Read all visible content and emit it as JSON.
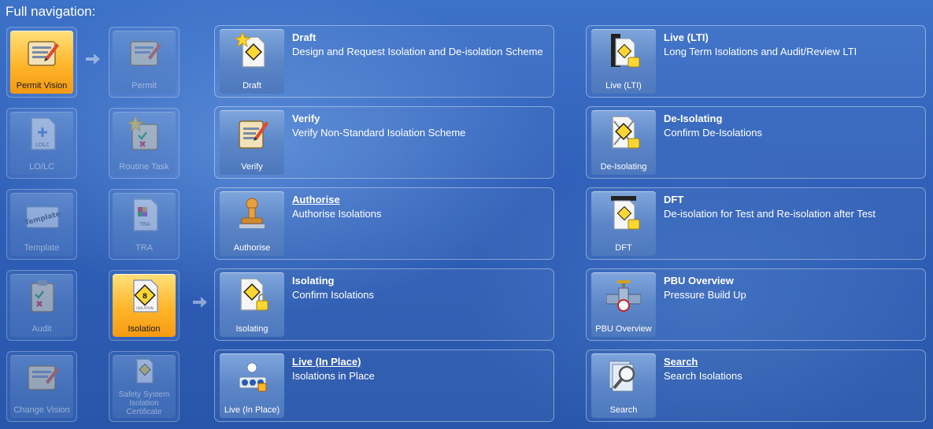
{
  "heading": "Full navigation:",
  "left_tiles": [
    {
      "label": "Permit Vision",
      "icon": "permit-vision-icon",
      "state": "active"
    },
    {
      "label": "Permit",
      "icon": "permit-icon",
      "state": "dim"
    },
    {
      "label": "LO/LC",
      "icon": "lolc-icon",
      "state": "dim"
    },
    {
      "label": "Routine Task",
      "icon": "routine-task-icon",
      "state": "dim"
    },
    {
      "label": "Template",
      "icon": "template-icon",
      "state": "dim"
    },
    {
      "label": "TRA",
      "icon": "tra-icon",
      "state": "dim"
    },
    {
      "label": "Audit",
      "icon": "audit-icon",
      "state": "dim"
    },
    {
      "label": "Isolation",
      "icon": "isolation-icon",
      "state": "active"
    },
    {
      "label": "Change Vision",
      "icon": "change-vision-icon",
      "state": "dim"
    },
    {
      "label": "Safety System Isolation Certificate",
      "icon": "safety-cert-icon",
      "state": "dim"
    }
  ],
  "icon_text": {
    "lolc": "LOLC",
    "template": "Template",
    "tra": "TRA",
    "isolation": "ISOLATION"
  },
  "cards_mid": [
    {
      "label": "Draft",
      "title": "Draft",
      "desc": "Design and Request Isolation and De-isolation Scheme",
      "underline": false
    },
    {
      "label": "Verify",
      "title": "Verify",
      "desc": "Verify Non-Standard Isolation Scheme",
      "underline": false
    },
    {
      "label": "Authorise",
      "title": "Authorise",
      "desc": "Authorise Isolations",
      "underline": true
    },
    {
      "label": "Isolating",
      "title": "Isolating",
      "desc": "Confirm Isolations",
      "underline": false
    },
    {
      "label": "Live (In Place)",
      "title": "Live (In Place)",
      "desc": "Isolations in Place",
      "underline": true
    }
  ],
  "cards_right": [
    {
      "label": "Live (LTI)",
      "title": "Live (LTI)",
      "desc": "Long Term Isolations and Audit/Review LTI",
      "underline": false
    },
    {
      "label": "De-Isolating",
      "title": "De-Isolating",
      "desc": "Confirm De-Isolations",
      "underline": false
    },
    {
      "label": "DFT",
      "title": "DFT",
      "desc": "De-isolation for Test and Re-isolation after Test",
      "underline": false
    },
    {
      "label": "PBU Overview",
      "title": "PBU Overview",
      "desc": "Pressure Build Up",
      "underline": false
    },
    {
      "label": "Search",
      "title": "Search",
      "desc": "Search Isolations",
      "underline": true
    }
  ]
}
